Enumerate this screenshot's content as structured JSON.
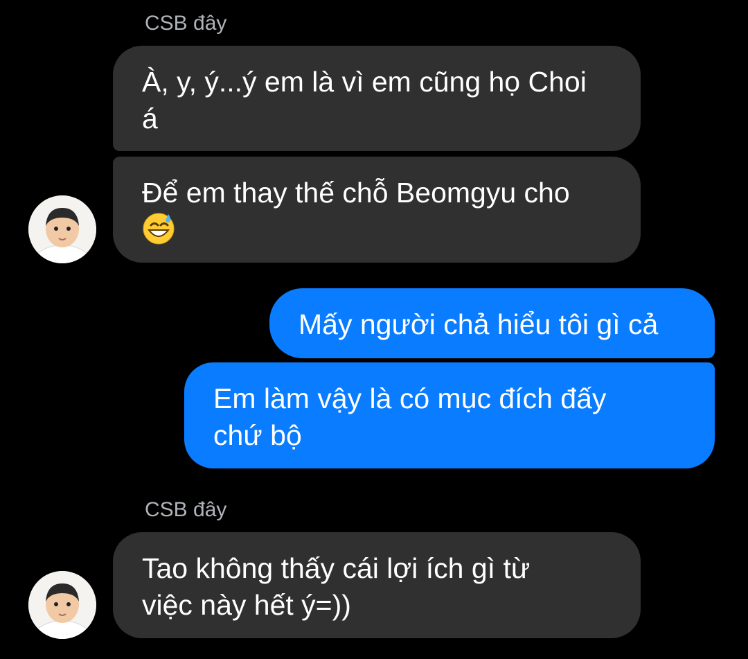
{
  "chat": {
    "groups": [
      {
        "sender": "CSB đây",
        "messages": [
          {
            "lines": [
              "À, y, ý...ý em là vì em cũng họ Choi",
              "á"
            ]
          },
          {
            "lines": [
              "Để em thay thế chỗ Beomgyu cho"
            ],
            "emoji": "grinning-sweat-icon"
          }
        ]
      },
      {
        "sender": "me",
        "messages": [
          {
            "lines": [
              "Mấy người chả hiểu tôi gì cả"
            ]
          },
          {
            "lines": [
              "Em làm vậy là có mục đích đấy",
              "chứ bộ"
            ]
          }
        ]
      },
      {
        "sender": "CSB đây",
        "messages": [
          {
            "lines": [
              "Tao không thấy cái lợi ích gì từ",
              "việc này hết ý=))"
            ]
          }
        ]
      }
    ]
  },
  "colors": {
    "background": "#000000",
    "incoming_bubble": "#303030",
    "outgoing_bubble": "#0a7cff",
    "sender_name": "#b0b3b8"
  }
}
